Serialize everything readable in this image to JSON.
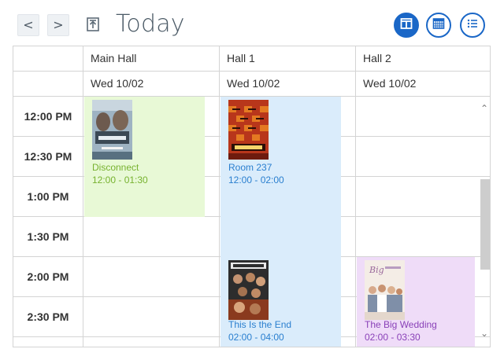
{
  "toolbar": {
    "prev_label": "<",
    "next_label": ">",
    "today_icon": "export-today-icon",
    "title": "Today",
    "views": [
      {
        "name": "day-view-icon",
        "active": true
      },
      {
        "name": "month-view-icon",
        "active": false
      },
      {
        "name": "list-view-icon",
        "active": false
      }
    ],
    "accent_color": "#1a67c7"
  },
  "resources": [
    {
      "name": "Main Hall",
      "date": "Wed 10/02"
    },
    {
      "name": "Hall 1",
      "date": "Wed 10/02"
    },
    {
      "name": "Hall 2",
      "date": "Wed 10/02"
    }
  ],
  "time_slots": [
    "12:00 PM",
    "12:30 PM",
    "1:00 PM",
    "1:30 PM",
    "2:00 PM",
    "2:30 PM"
  ],
  "events": [
    {
      "title": "Disconnect",
      "time": "12:00 - 01:30",
      "color": "#77b22f",
      "bg": "#e8f9d6"
    },
    {
      "title": "Room 237",
      "time": "12:00 - 02:00",
      "color": "#2a7fcf",
      "bg": "#daecfb"
    },
    {
      "title": "This Is the End",
      "time": "02:00 - 04:00",
      "color": "#2a7fcf",
      "bg": "#daecfb"
    },
    {
      "title": "The Big Wedding",
      "time": "02:00 - 03:30",
      "color": "#8a42b8",
      "bg": "#efdcf8"
    }
  ]
}
